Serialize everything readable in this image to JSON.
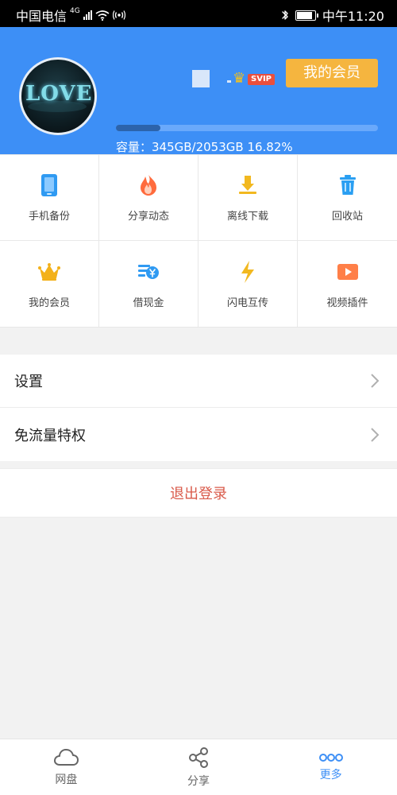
{
  "status_bar": {
    "carrier": "中国电信",
    "network": "4G",
    "time": "中午11:20",
    "icons": {
      "signal": "signal-icon",
      "wifi": "wifi-icon",
      "hotspot": "hotspot-icon",
      "bluetooth": "bluetooth-icon",
      "battery": "battery-icon"
    },
    "battery_level": 0.9
  },
  "header": {
    "svip_badge": "SVIP",
    "member_button_label": "我的会员",
    "capacity_text": "容量：345GB/2053GB 16.82%",
    "used_fraction": 0.1682,
    "avatar_text": "LOVE",
    "colors": {
      "header": "#3d8ff6",
      "member_button": "#f5b53f",
      "svip": "#ea4f3d",
      "progress": "#2c63ab"
    }
  },
  "grid": [
    {
      "label": "手机备份",
      "icon": "phone-icon",
      "color": "#2f9af2"
    },
    {
      "label": "分享动态",
      "icon": "fire-icon",
      "color": "#ff6b3d"
    },
    {
      "label": "离线下载",
      "icon": "download-icon",
      "color": "#f2b81f"
    },
    {
      "label": "回收站",
      "icon": "trash-icon",
      "color": "#2a9ff2"
    },
    {
      "label": "我的会员",
      "icon": "crown-icon",
      "color": "#f3b11a"
    },
    {
      "label": "借现金",
      "icon": "cash-icon",
      "color": "#2f9af2"
    },
    {
      "label": "闪电互传",
      "icon": "lightning-icon",
      "color": "#f2b81f"
    },
    {
      "label": "视频插件",
      "icon": "video-icon",
      "color": "#ff7f48"
    }
  ],
  "menu": [
    {
      "label": "设置"
    },
    {
      "label": "免流量特权"
    }
  ],
  "logout_label": "退出登录",
  "bottom_nav": [
    {
      "label": "网盘",
      "icon": "cloud-icon",
      "active": false
    },
    {
      "label": "分享",
      "icon": "share-icon",
      "active": false
    },
    {
      "label": "更多",
      "icon": "more-icon",
      "active": true
    }
  ]
}
